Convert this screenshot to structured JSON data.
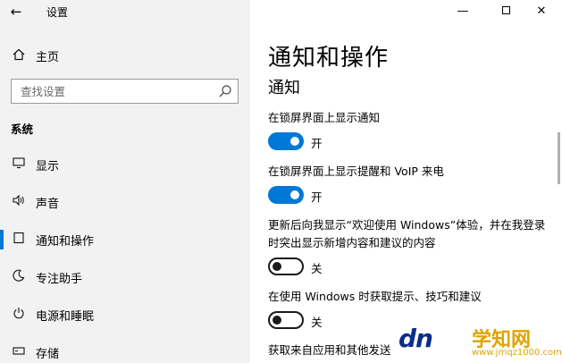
{
  "window": {
    "title": "设置",
    "back_glyph": "←",
    "min_glyph": "—",
    "close_glyph": "✕"
  },
  "sidebar": {
    "home": {
      "label": "主页",
      "icon": "home-icon"
    },
    "search": {
      "placeholder": "查找设置"
    },
    "section": "系统",
    "items": [
      {
        "label": "显示",
        "icon": "monitor-icon",
        "active": false
      },
      {
        "label": "声音",
        "icon": "speaker-icon",
        "active": false
      },
      {
        "label": "通知和操作",
        "icon": "notification-icon",
        "active": true
      },
      {
        "label": "专注助手",
        "icon": "moon-icon",
        "active": false
      },
      {
        "label": "电源和睡眠",
        "icon": "power-icon",
        "active": false
      },
      {
        "label": "存储",
        "icon": "storage-icon",
        "active": false
      }
    ]
  },
  "main": {
    "title": "通知和操作",
    "subhead": "通知",
    "settings": [
      {
        "label": "在锁屏界面上显示通知",
        "on": true,
        "state": "开"
      },
      {
        "label": "在锁屏界面上显示提醒和 VoIP 来电",
        "on": true,
        "state": "开"
      },
      {
        "label": "更新后向我显示“欢迎使用 Windows”体验，并在我登录时突出显示新增内容和建议的内容",
        "on": false,
        "state": "关"
      },
      {
        "label": "在使用 Windows 时获取提示、技巧和建议",
        "on": false,
        "state": "关"
      },
      {
        "label": "获取来自应用和其他发送"
      }
    ]
  },
  "watermark": {
    "logo": "dn",
    "text": "学知网",
    "url": "www.jmqz1000.com"
  },
  "colors": {
    "accent": "#0078d7",
    "sidebar_bg": "#f2f2f2"
  }
}
